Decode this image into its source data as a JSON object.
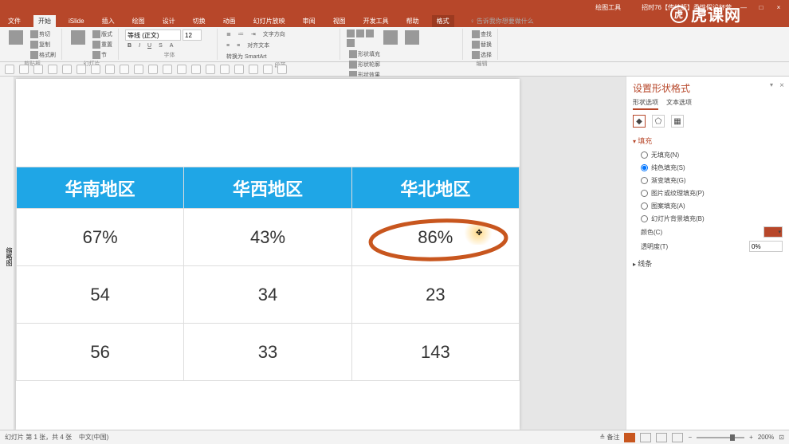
{
  "titlebar": {
    "context": "绘图工具",
    "filename": "招时76【传统版】柔性假设杯营",
    "active_context_tab": "格式",
    "win_min": "—",
    "win_max": "□",
    "win_close": "×"
  },
  "tabs": [
    "文件",
    "开始",
    "iSlide",
    "插入",
    "绘图",
    "设计",
    "切换",
    "动画",
    "幻灯片放映",
    "审阅",
    "视图",
    "开发工具",
    "帮助",
    "格式"
  ],
  "active_tab": "开始",
  "search_placeholder": "告诉我你想要做什么",
  "ribbon": {
    "clipboard": {
      "label": "剪贴板",
      "paste": "粘贴",
      "cut": "剪切",
      "copy": "复制",
      "format_painter": "格式刷"
    },
    "slides": {
      "label": "幻灯片",
      "new": "新建幻灯片",
      "layout": "版式",
      "reset": "重置",
      "section": "节"
    },
    "font": {
      "label": "字体",
      "family": "等线 (正文)",
      "size": "12"
    },
    "paragraph": {
      "label": "段落",
      "text_direction": "文字方向",
      "align_text": "对齐文本",
      "smartart": "转换为 SmartArt"
    },
    "drawing": {
      "label": "绘图",
      "arrange": "排列",
      "quick_styles": "快速样式",
      "shape_fill": "形状填充",
      "shape_outline": "形状轮廓",
      "shape_effects": "形状效果"
    },
    "editing": {
      "label": "编辑",
      "find": "查找",
      "replace": "替换",
      "select": "选择"
    }
  },
  "chart_data": {
    "type": "table",
    "columns": [
      "华南地区",
      "华西地区",
      "华北地区"
    ],
    "rows": [
      [
        "67%",
        "43%",
        "86%"
      ],
      [
        "54",
        "34",
        "23"
      ],
      [
        "56",
        "33",
        "143"
      ]
    ]
  },
  "pane": {
    "title": "设置形状格式",
    "tab_shape": "形状选项",
    "tab_text": "文本选项",
    "section_fill": "填充",
    "fill_options": {
      "none": "无填充(N)",
      "solid": "纯色填充(S)",
      "gradient": "渐变填充(G)",
      "picture": "图片或纹理填充(P)",
      "pattern": "图案填充(A)",
      "slide_bg": "幻灯片背景填充(B)"
    },
    "color_label": "颜色(C)",
    "transparency_label": "透明度(T)",
    "transparency_value": "0%",
    "section_line": "线条"
  },
  "statusbar": {
    "slide_info": "幻灯片 第 1 张，共 4 张",
    "lang": "中文(中国)",
    "notes": "备注",
    "zoom": "200%"
  },
  "watermark": "虎课网"
}
